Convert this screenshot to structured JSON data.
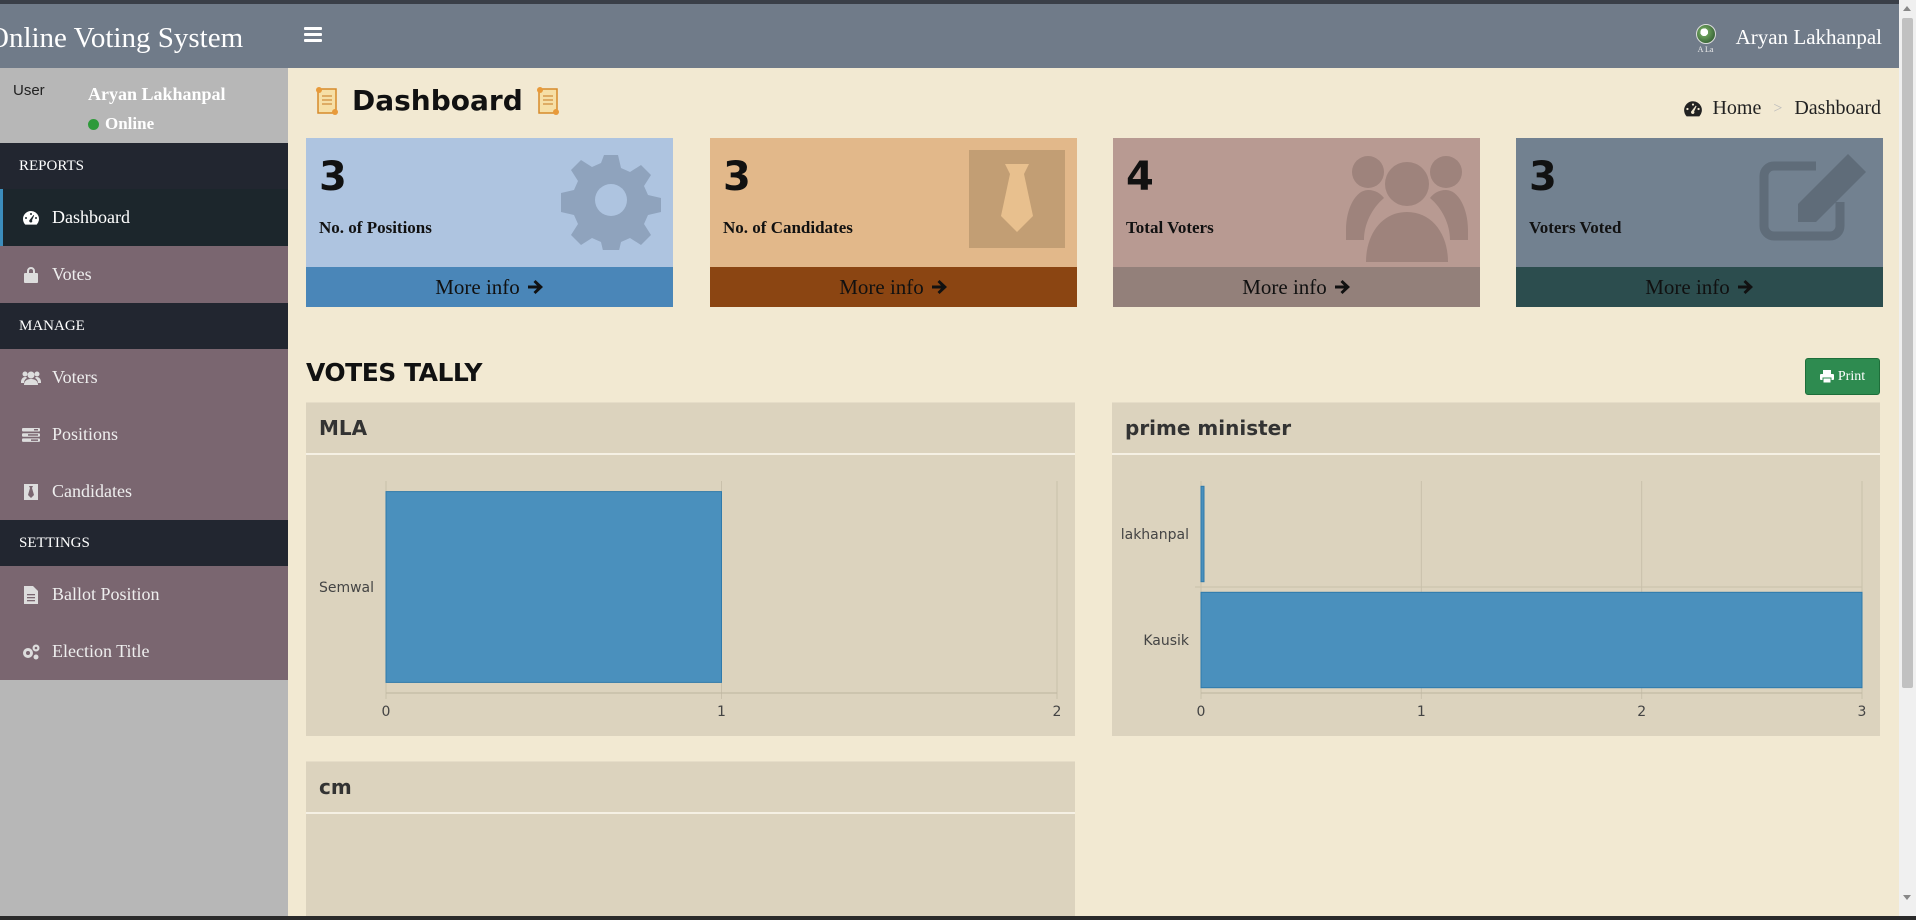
{
  "header": {
    "brand": "Online Voting System",
    "user_name": "Aryan Lakhanpal",
    "avatar_caption": "A La"
  },
  "sidebar": {
    "user_image_alt": "User",
    "user_name": "Aryan Lakhanpal",
    "status": "Online",
    "sections": [
      {
        "header": "REPORTS",
        "items": [
          {
            "label": "Dashboard",
            "icon": "dashboard-icon",
            "active": true
          },
          {
            "label": "Votes",
            "icon": "lock-icon"
          }
        ]
      },
      {
        "header": "MANAGE",
        "items": [
          {
            "label": "Voters",
            "icon": "users-icon"
          },
          {
            "label": "Positions",
            "icon": "tasks-icon"
          },
          {
            "label": "Candidates",
            "icon": "black-tie-icon"
          }
        ]
      },
      {
        "header": "SETTINGS",
        "items": [
          {
            "label": "Ballot Position",
            "icon": "file-text-icon"
          },
          {
            "label": "Election Title",
            "icon": "cogs-icon"
          }
        ]
      }
    ]
  },
  "page": {
    "title": "Dashboard",
    "breadcrumb": {
      "home": "Home",
      "current": "Dashboard"
    }
  },
  "stats": [
    {
      "value": "3",
      "label": "No. of Positions",
      "more": "More info",
      "icon": "gear-icon",
      "bg": "#aec4e0",
      "footer": "#4a86b8",
      "icon_color": "#8fa3bd"
    },
    {
      "value": "3",
      "label": "No. of Candidates",
      "more": "More info",
      "icon": "tie-icon",
      "bg": "#e2b88a",
      "footer": "#8b4512",
      "icon_color": "#c29e74"
    },
    {
      "value": "4",
      "label": "Total Voters",
      "more": "More info",
      "icon": "users-icon",
      "bg": "#b89a92",
      "footer": "#93807a",
      "icon_color": "#9e837c"
    },
    {
      "value": "3",
      "label": "Voters Voted",
      "more": "More info",
      "icon": "edit-icon",
      "bg": "#728190",
      "footer": "#2c4d4e",
      "icon_color": "#5f6c79"
    }
  ],
  "tally": {
    "title": "VOTES TALLY",
    "print_label": "Print"
  },
  "chart_data": [
    {
      "type": "bar",
      "orientation": "horizontal",
      "title": "MLA",
      "categories": [
        "Semwal"
      ],
      "values": [
        1
      ],
      "xlim": [
        0,
        2
      ],
      "xticks": [
        "0",
        "1",
        "2"
      ],
      "color": "#4a90bd",
      "grid": true
    },
    {
      "type": "bar",
      "orientation": "horizontal",
      "title": "prime minister",
      "categories": [
        "lakhanpal",
        "Kausik"
      ],
      "values": [
        0,
        3
      ],
      "xlim": [
        0,
        3
      ],
      "xticks": [
        "0",
        "1",
        "2",
        "3"
      ],
      "color": "#4a90bd",
      "grid": true
    },
    {
      "type": "bar",
      "orientation": "horizontal",
      "title": "cm",
      "categories": [],
      "values": []
    }
  ]
}
